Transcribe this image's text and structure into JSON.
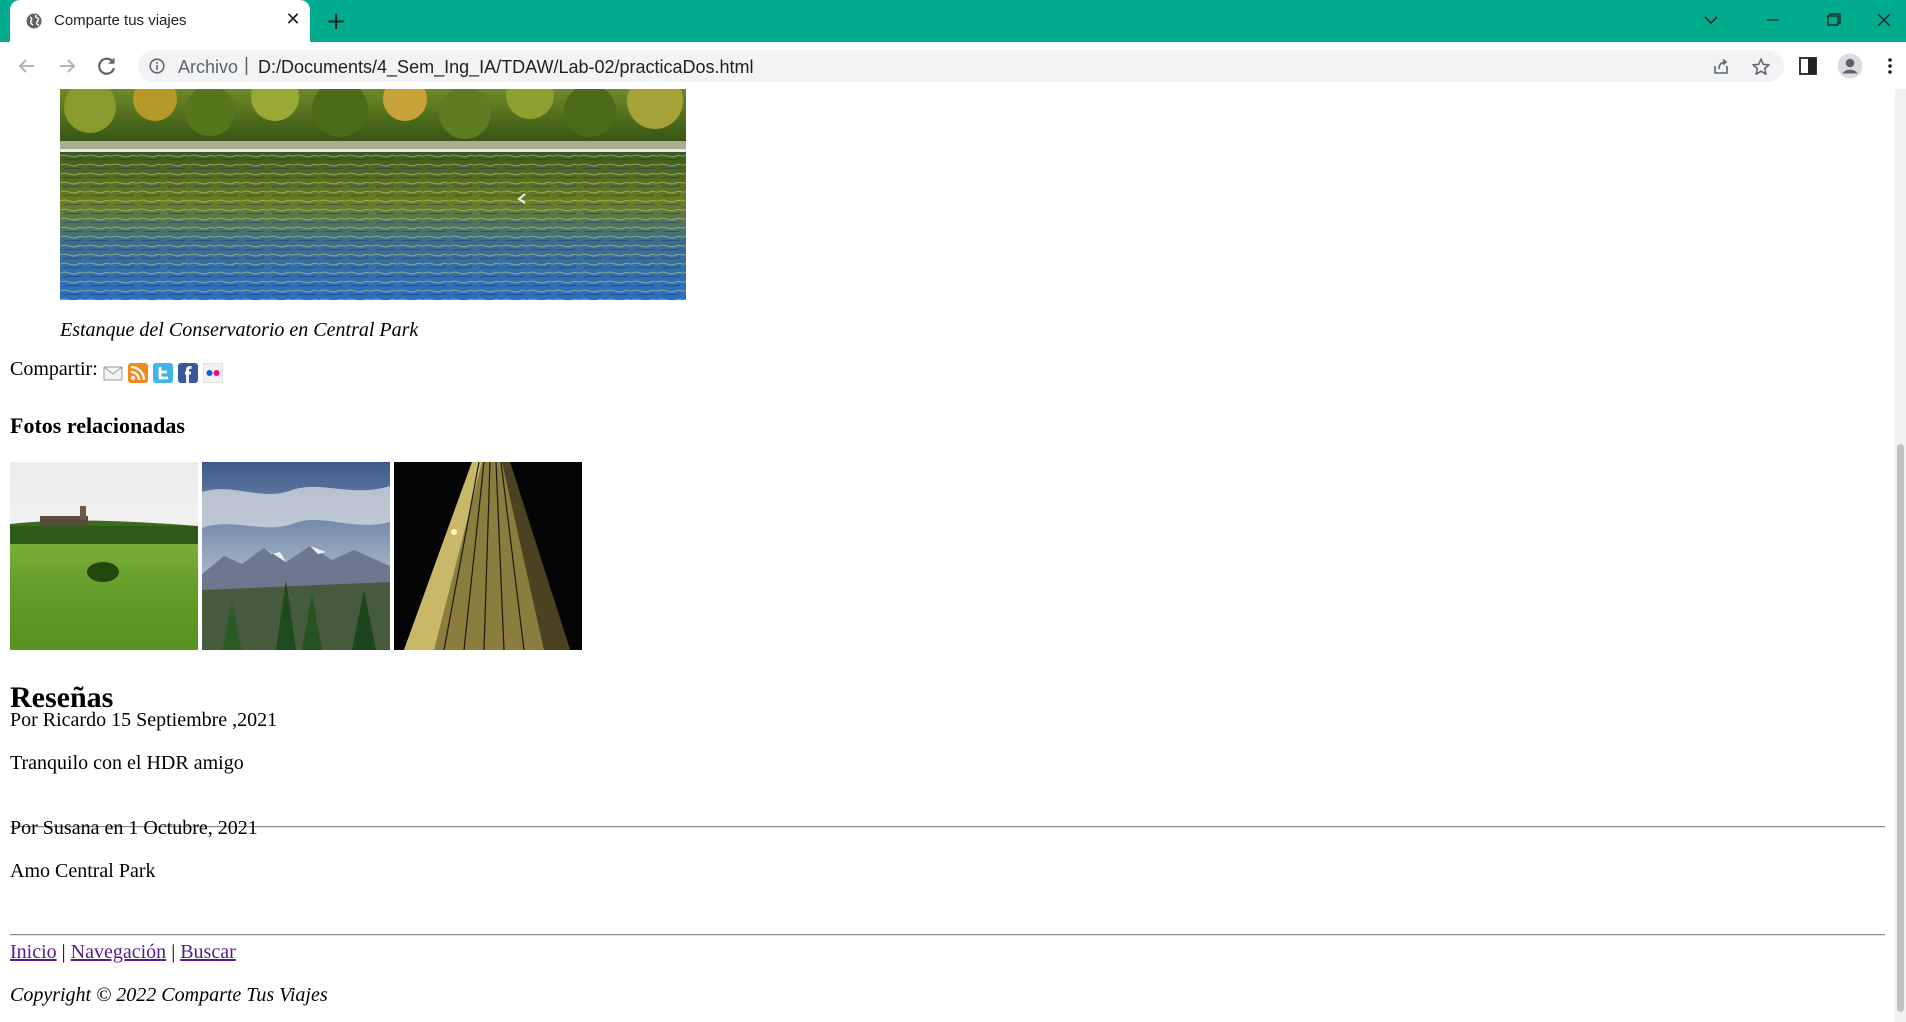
{
  "browser": {
    "tab_title": "Comparte tus viajes",
    "address_scheme": "Archivo",
    "address_separator": "|",
    "url": "D:/Documents/4_Sem_Ing_IA/TDAW/Lab-02/practicaDos.html",
    "accent_color": "#00ab8e"
  },
  "page": {
    "hero_caption": "Estanque del Conservatorio en Central Park",
    "share_label": "Compartir:",
    "share_icons": [
      "email-icon",
      "rss-icon",
      "twitter-icon",
      "facebook-icon",
      "flickr-icon"
    ],
    "related_title": "Fotos relacionadas",
    "reviews_title": "Reseñas",
    "reviews": [
      {
        "byline": "Por Ricardo 15 Septiembre ,2021",
        "text": "Tranquilo con el HDR amigo"
      },
      {
        "byline": "Por Susana en 1 Octubre, 2021",
        "text": "Amo Central Park"
      }
    ],
    "footer": {
      "links": [
        "Inicio",
        "Navegación",
        "Buscar"
      ],
      "divider": "|",
      "copyright": "Copyright © 2022 Comparte Tus Viajes"
    }
  }
}
